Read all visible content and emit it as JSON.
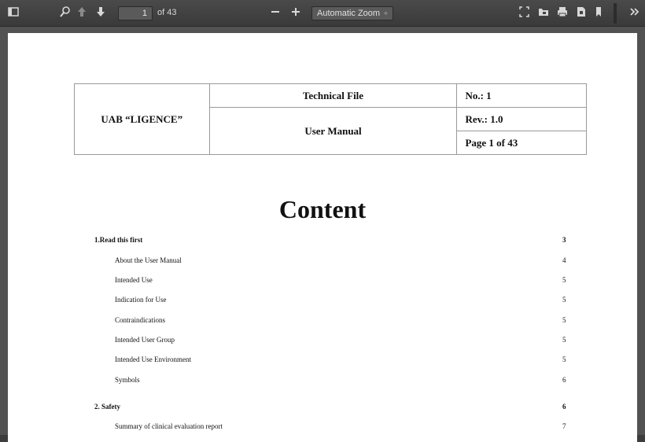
{
  "toolbar": {
    "page_number": "1",
    "page_of": "of 43",
    "zoom_label": "Automatic Zoom",
    "zoom_arrows": "÷"
  },
  "header": {
    "company": "UAB “LIGENCE”",
    "technical_file": "Technical File",
    "user_manual": "User Manual",
    "number": "No.: 1",
    "revision": "Rev.: 1.0",
    "page": "Page 1 of 43"
  },
  "content_title": "Content",
  "toc": [
    {
      "label": "1.Read this first",
      "page": "3",
      "level": "section"
    },
    {
      "label": "About the User Manual",
      "page": "4",
      "level": "sub"
    },
    {
      "label": "Intended Use",
      "page": "5",
      "level": "sub"
    },
    {
      "label": "Indication for Use",
      "page": "5",
      "level": "sub"
    },
    {
      "label": "Contraindications",
      "page": "5",
      "level": "sub"
    },
    {
      "label": "Intended User Group",
      "page": "5",
      "level": "sub"
    },
    {
      "label": "Intended Use Environment",
      "page": "5",
      "level": "sub"
    },
    {
      "label": "Symbols",
      "page": "6",
      "level": "sub"
    },
    {
      "label": "2. Safety",
      "page": "6",
      "level": "section"
    },
    {
      "label": "Summary of clinical evaluation report",
      "page": "7",
      "level": "sub"
    }
  ]
}
